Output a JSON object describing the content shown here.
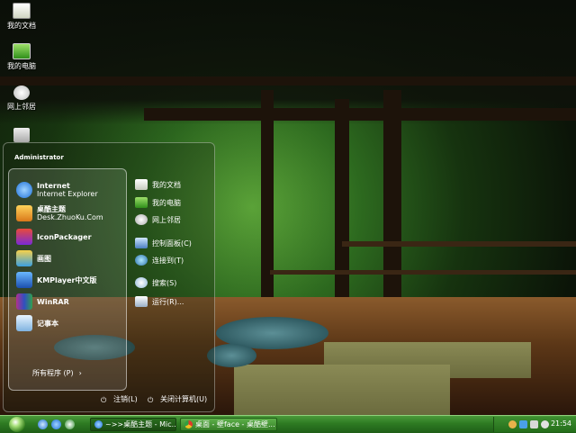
{
  "desktop": {
    "icons": [
      {
        "label": "我的文档",
        "icon": "folder-documents-icon"
      },
      {
        "label": "我的电脑",
        "icon": "computer-icon"
      },
      {
        "label": "网上邻居",
        "icon": "network-icon"
      },
      {
        "label": "",
        "icon": "recycle-bin-icon"
      }
    ]
  },
  "start_menu": {
    "user": "Administrator",
    "pinned": [
      {
        "line1": "Internet",
        "line2": "Internet Explorer",
        "icon": "internet-explorer-icon"
      },
      {
        "line1": "桌酷主题",
        "line2": "Desk.ZhuoKu.Com",
        "icon": "zhuoku-icon"
      }
    ],
    "programs": [
      {
        "label": "IconPackager",
        "icon": "iconpackager-icon"
      },
      {
        "label": "画图",
        "icon": "paint-icon"
      },
      {
        "label": "KMPlayer中文版",
        "icon": "kmplayer-icon"
      },
      {
        "label": "WinRAR",
        "icon": "winrar-icon"
      },
      {
        "label": "记事本",
        "icon": "notepad-icon"
      }
    ],
    "all_programs": "所有程序 (P)",
    "places": [
      {
        "label": "我的文档",
        "icon": "documents-icon"
      },
      {
        "label": "我的电脑",
        "icon": "computer-icon"
      },
      {
        "label": "网上邻居",
        "icon": "network-icon"
      },
      {
        "label": "控制面板(C)",
        "icon": "control-panel-icon"
      },
      {
        "label": "连接到(T)",
        "icon": "connect-icon"
      },
      {
        "label": "搜索(S)",
        "icon": "search-icon"
      },
      {
        "label": "运行(R)...",
        "icon": "run-icon"
      }
    ],
    "logoff": "注销(L)",
    "shutdown": "关闭计算机(U)"
  },
  "taskbar": {
    "tasks": [
      {
        "label": "~>>桌酷主题 - Mic...",
        "icon": "ie-icon"
      },
      {
        "label": "桌面 - 壁face - 桌酷壁...",
        "icon": "chrome-icon"
      }
    ],
    "clock": "21:54"
  },
  "colors": {
    "taskbar": "#2d7a22",
    "accent": "#4a9a3a"
  }
}
